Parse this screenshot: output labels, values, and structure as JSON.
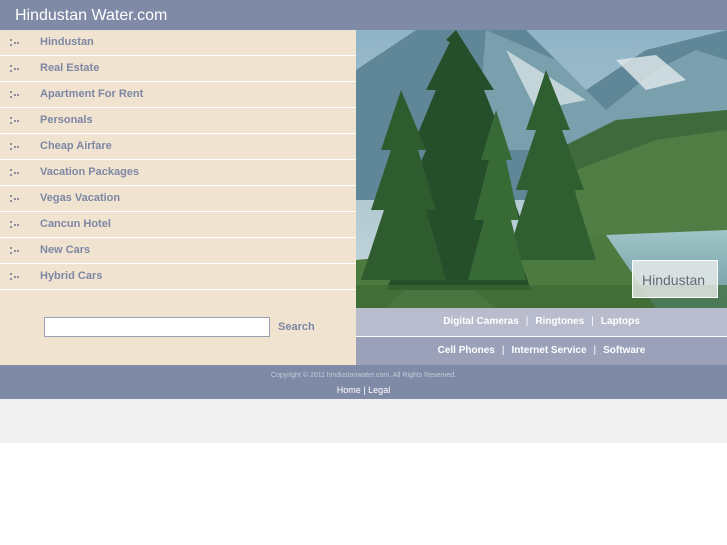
{
  "header": {
    "site_title": "Hindustan Water.com"
  },
  "sidebar": {
    "items": [
      {
        "label": "Hindustan"
      },
      {
        "label": "Real Estate"
      },
      {
        "label": "Apartment For Rent"
      },
      {
        "label": "Personals"
      },
      {
        "label": "Cheap Airfare"
      },
      {
        "label": "Vacation Packages"
      },
      {
        "label": "Vegas Vacation"
      },
      {
        "label": "Cancun Hotel"
      },
      {
        "label": "New Cars"
      },
      {
        "label": "Hybrid Cars"
      }
    ],
    "bullet_icon": "dotted-bullet-icon"
  },
  "search": {
    "input_value": "",
    "button_label": "Search"
  },
  "hero": {
    "caption": "Hindustan",
    "image_subject": "pine-forest-mountain-river-photo"
  },
  "links_row1": {
    "link1": "Digital Cameras",
    "link2": "Ringtones",
    "link3": "Laptops",
    "sep": "|"
  },
  "links_row2": {
    "link1": "Cell Phones",
    "link2": "Internet Service",
    "link3": "Software",
    "sep": "|"
  },
  "footer": {
    "copyright": "Copyright © 2011 hindustanwater.com. All Rights Reserved.",
    "home_label": "Home",
    "sep": "|",
    "legal_label": "Legal"
  },
  "colors": {
    "header_bg": "#7f8aa6",
    "sidebar_bg": "#f0e4d0",
    "nav_text": "#7d86a4",
    "linkbar_light": "#b8bccd",
    "linkbar_dark": "#9aa1b9",
    "band_bg": "#f0f0f0"
  }
}
